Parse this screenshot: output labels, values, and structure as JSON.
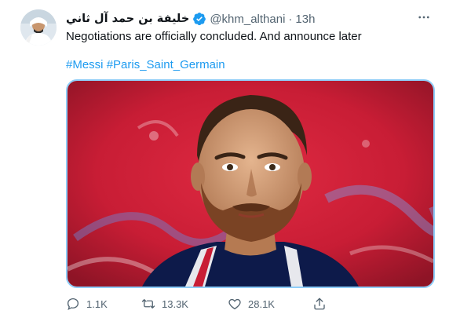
{
  "tweet": {
    "author": {
      "display_name": "خليفة بن حمد آل ثاني",
      "handle": "@khm_althani",
      "verified": true,
      "avatar_icon": "profile-photo"
    },
    "separator": "·",
    "time": "13h",
    "text": "Negotiations are officially concluded. And announce later",
    "hashtags": [
      "#Messi",
      "#Paris_Saint_Germain"
    ],
    "media": {
      "type": "photo",
      "accent_color": "#d1203a"
    },
    "actions": {
      "reply": {
        "icon": "reply-icon",
        "count": "1.1K"
      },
      "retweet": {
        "icon": "retweet-icon",
        "count": "13.3K"
      },
      "like": {
        "icon": "like-icon",
        "count": "28.1K"
      },
      "share": {
        "icon": "share-icon"
      }
    },
    "more_icon": "more-options-icon"
  },
  "colors": {
    "link": "#1d9bf0",
    "verified": "#1d9bf0",
    "secondary_text": "#536471",
    "media_border": "#8ecdf8"
  }
}
